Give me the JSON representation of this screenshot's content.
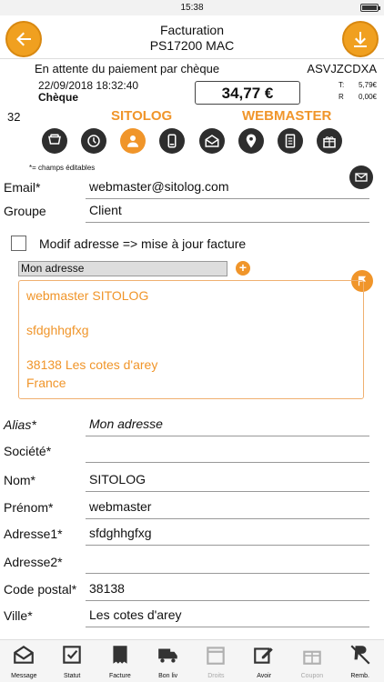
{
  "statusbar": {
    "time": "15:38"
  },
  "header": {
    "title_line1": "Facturation",
    "title_line2": "PS17200 MAC"
  },
  "info": {
    "status": "En attente du paiement par chèque",
    "ref": "ASVJZCDXA",
    "date": "22/09/2018 18:32:40",
    "payment_method": "Chèque",
    "amount": "34,77 €",
    "tax_t_label": "T:",
    "tax_t_value": "5,79€",
    "tax_r_label": "R",
    "tax_r_value": "0,00€"
  },
  "customer": {
    "number": "32",
    "company": "SITOLOG",
    "username": "WEBMASTER"
  },
  "tabs": [
    {
      "icon": "cart-icon"
    },
    {
      "icon": "history-icon"
    },
    {
      "icon": "user-icon"
    },
    {
      "icon": "phone-icon"
    },
    {
      "icon": "envelope-icon"
    },
    {
      "icon": "location-icon"
    },
    {
      "icon": "document-icon"
    },
    {
      "icon": "gift-icon"
    }
  ],
  "note": "*= champs éditables",
  "fields": {
    "email_label": "Email*",
    "email_value": "webmaster@sitolog.com",
    "group_label": "Groupe",
    "group_value": "Client"
  },
  "modif_address": {
    "label": "Modif adresse => mise à jour facture"
  },
  "address_select": {
    "value": "Mon adresse"
  },
  "address_box": {
    "line1": "webmaster SITOLOG",
    "line2": "sfdghhgfxg",
    "line3": "38138 Les cotes d'arey",
    "line4": "France"
  },
  "address_form": {
    "alias_label": "Alias*",
    "alias_value": "Mon adresse",
    "societe_label": "Société*",
    "societe_value": "",
    "nom_label": "Nom*",
    "nom_value": "SITOLOG",
    "prenom_label": "Prénom*",
    "prenom_value": "webmaster",
    "adresse1_label": "Adresse1*",
    "adresse1_value": "sfdghhgfxg",
    "adresse2_label": "Adresse2*",
    "adresse2_value": "",
    "cp_label": "Code postal*",
    "cp_value": "38138",
    "ville_label": "Ville*",
    "ville_value": "Les cotes d'arey"
  },
  "bottom_nav": [
    {
      "label": "Message",
      "icon": "message-icon"
    },
    {
      "label": "Statut",
      "icon": "checkbox-icon"
    },
    {
      "label": "Facture",
      "icon": "invoice-icon"
    },
    {
      "label": "Bon liv",
      "icon": "truck-icon"
    },
    {
      "label": "Droits",
      "icon": "calendar-icon"
    },
    {
      "label": "Avoir",
      "icon": "edit-icon"
    },
    {
      "label": "Coupon",
      "icon": "gift-icon"
    },
    {
      "label": "Remb.",
      "icon": "paypal-icon"
    }
  ],
  "colors": {
    "accent": "#f0952a",
    "dark": "#2e2e2e"
  }
}
